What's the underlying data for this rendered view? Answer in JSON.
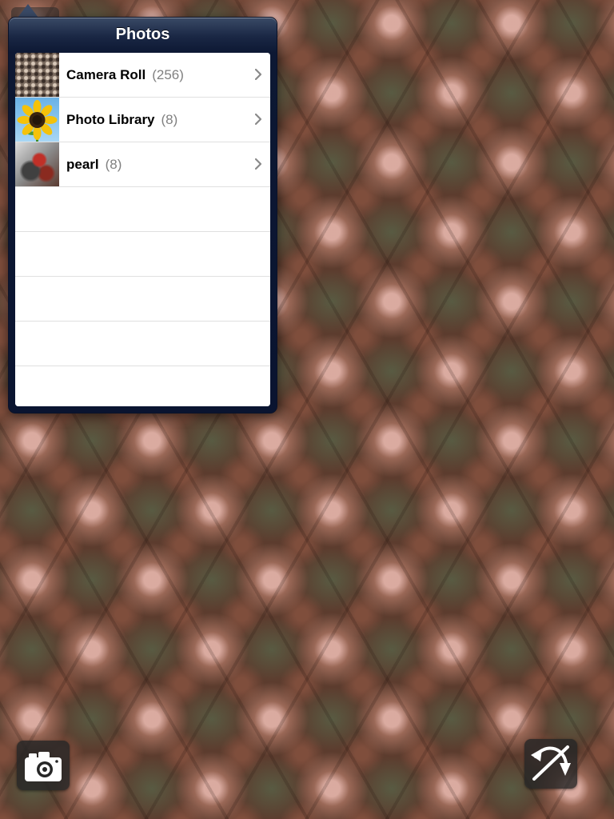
{
  "popover": {
    "title": "Photos",
    "albums": [
      {
        "name": "Camera Roll",
        "count": "(256)",
        "thumb": "camera-roll-thumbnail"
      },
      {
        "name": "Photo Library",
        "count": "(8)",
        "thumb": "sunflower-thumbnail"
      },
      {
        "name": "pearl",
        "count": "(8)",
        "thumb": "pearl-thumbnail"
      }
    ],
    "empty_rows": 5
  },
  "toolbar": {
    "camera_icon": "camera-icon",
    "flip_icon": "flip-direction-icon"
  },
  "colors": {
    "popover_header": "#1a2744",
    "list_background": "#ffffff",
    "count_text": "#808080",
    "chevron": "#8a8a8a"
  }
}
